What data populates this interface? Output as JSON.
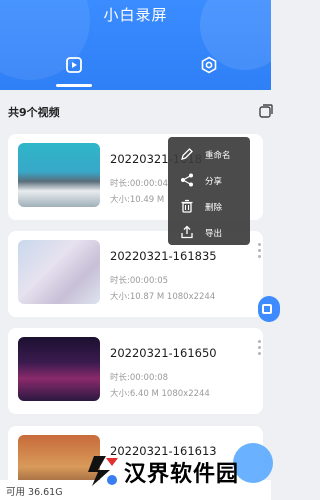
{
  "header": {
    "title": "小白录屏",
    "tabs": [
      {
        "icon": "video-tab-icon",
        "active": true
      },
      {
        "icon": "settings-gear-icon",
        "active": false
      }
    ]
  },
  "list": {
    "count_label": "共9个视频",
    "items": [
      {
        "name": "20220321-1618",
        "duration": "时长:00:00:04",
        "size": "大小:10.49 M"
      },
      {
        "name": "20220321-161835",
        "duration": "时长:00:00:05",
        "size": "大小:10.87 M  1080x2244"
      },
      {
        "name": "20220321-161650",
        "duration": "时长:00:00:08",
        "size": "大小:6.40 M  1080x2244"
      },
      {
        "name": "20220321-161613",
        "duration": "",
        "size": ""
      }
    ]
  },
  "context_menu": {
    "items": [
      {
        "label": "重命名",
        "icon": "edit-pencil-icon"
      },
      {
        "label": "分享",
        "icon": "share-icon"
      },
      {
        "label": "删除",
        "icon": "trash-icon"
      },
      {
        "label": "导出",
        "icon": "export-icon"
      }
    ]
  },
  "storage": {
    "text": "可用 36.61G"
  },
  "watermark": {
    "text": "汉界软件园"
  },
  "colors": {
    "accent": "#2f7ff6",
    "background": "#eef0f4"
  }
}
